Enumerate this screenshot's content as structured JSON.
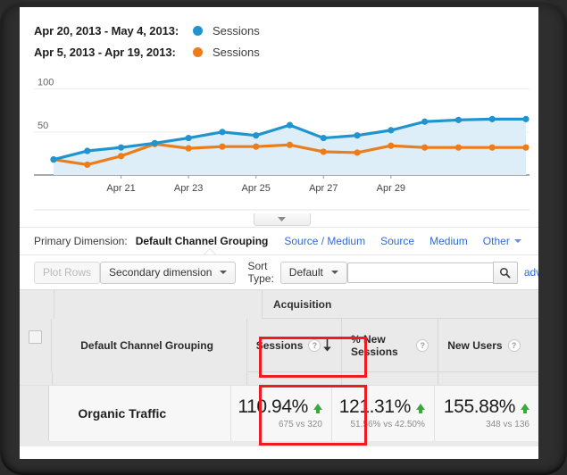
{
  "legend": {
    "rows": [
      {
        "date_range": "Apr 20, 2013 - May 4, 2013:",
        "metric": "Sessions",
        "color": "#1f94cf"
      },
      {
        "date_range": "Apr 5, 2013 - Apr 19, 2013:",
        "metric": "Sessions",
        "color": "#ec7d1a"
      }
    ]
  },
  "chart_data": {
    "type": "line",
    "title": "",
    "xlabel": "",
    "ylabel": "",
    "ylim": [
      0,
      110
    ],
    "yticks": [
      50,
      100
    ],
    "grid": true,
    "legend_position": "top",
    "x_tick_labels": [
      "Apr 21",
      "Apr 23",
      "Apr 25",
      "Apr 27",
      "Apr 29"
    ],
    "x_tick_indices": [
      2,
      4,
      6,
      8,
      10
    ],
    "x": [
      0,
      1,
      2,
      3,
      4,
      5,
      6,
      7,
      8,
      9,
      10,
      11,
      12,
      13,
      14
    ],
    "series": [
      {
        "name": "Sessions",
        "date_range": "Apr 20, 2013 - May 4, 2013",
        "color": "#1f94cf",
        "fill": "#ddeef8",
        "values": [
          18,
          28,
          32,
          37,
          43,
          50,
          46,
          58,
          43,
          46,
          52,
          62,
          64,
          65,
          65
        ]
      },
      {
        "name": "Sessions",
        "date_range": "Apr 5, 2013 - Apr 19, 2013",
        "color": "#ec7d1a",
        "fill": "none",
        "values": [
          18,
          12,
          22,
          36,
          31,
          33,
          33,
          35,
          27,
          26,
          34,
          32,
          32,
          32,
          32
        ]
      }
    ]
  },
  "primary_dimension": {
    "label": "Primary Dimension:",
    "active": "Default Channel Grouping",
    "links": [
      "Source / Medium",
      "Source",
      "Medium"
    ],
    "other": "Other"
  },
  "toolbar": {
    "plot_rows": "Plot Rows",
    "secondary_dimension": "Secondary dimension",
    "sort_type_label": "Sort Type:",
    "sort_type_value": "Default",
    "search_value": "",
    "search_placeholder": "",
    "search_icon": "search-icon",
    "advanced": "adv"
  },
  "table": {
    "group_header": "Acquisition",
    "dimension_header": "Default Channel Grouping",
    "metrics": [
      {
        "label": "Sessions",
        "help": "?",
        "sorted": true,
        "sort_dir": "desc"
      },
      {
        "label": "% New Sessions",
        "help": "?",
        "sorted": false
      },
      {
        "label": "New Users",
        "help": "?",
        "sorted": false
      }
    ],
    "rows": [
      {
        "dimension": "Organic Traffic",
        "cells": [
          {
            "pct": "110.94%",
            "direction": "up",
            "sub": "675 vs 320"
          },
          {
            "pct": "121.31%",
            "direction": "up",
            "sub": "51.56% vs 42.50%"
          },
          {
            "pct": "155.88%",
            "direction": "up",
            "sub": "348 vs 136"
          }
        ]
      }
    ]
  },
  "annotation": {
    "highlight_color": "#ee1c22"
  }
}
